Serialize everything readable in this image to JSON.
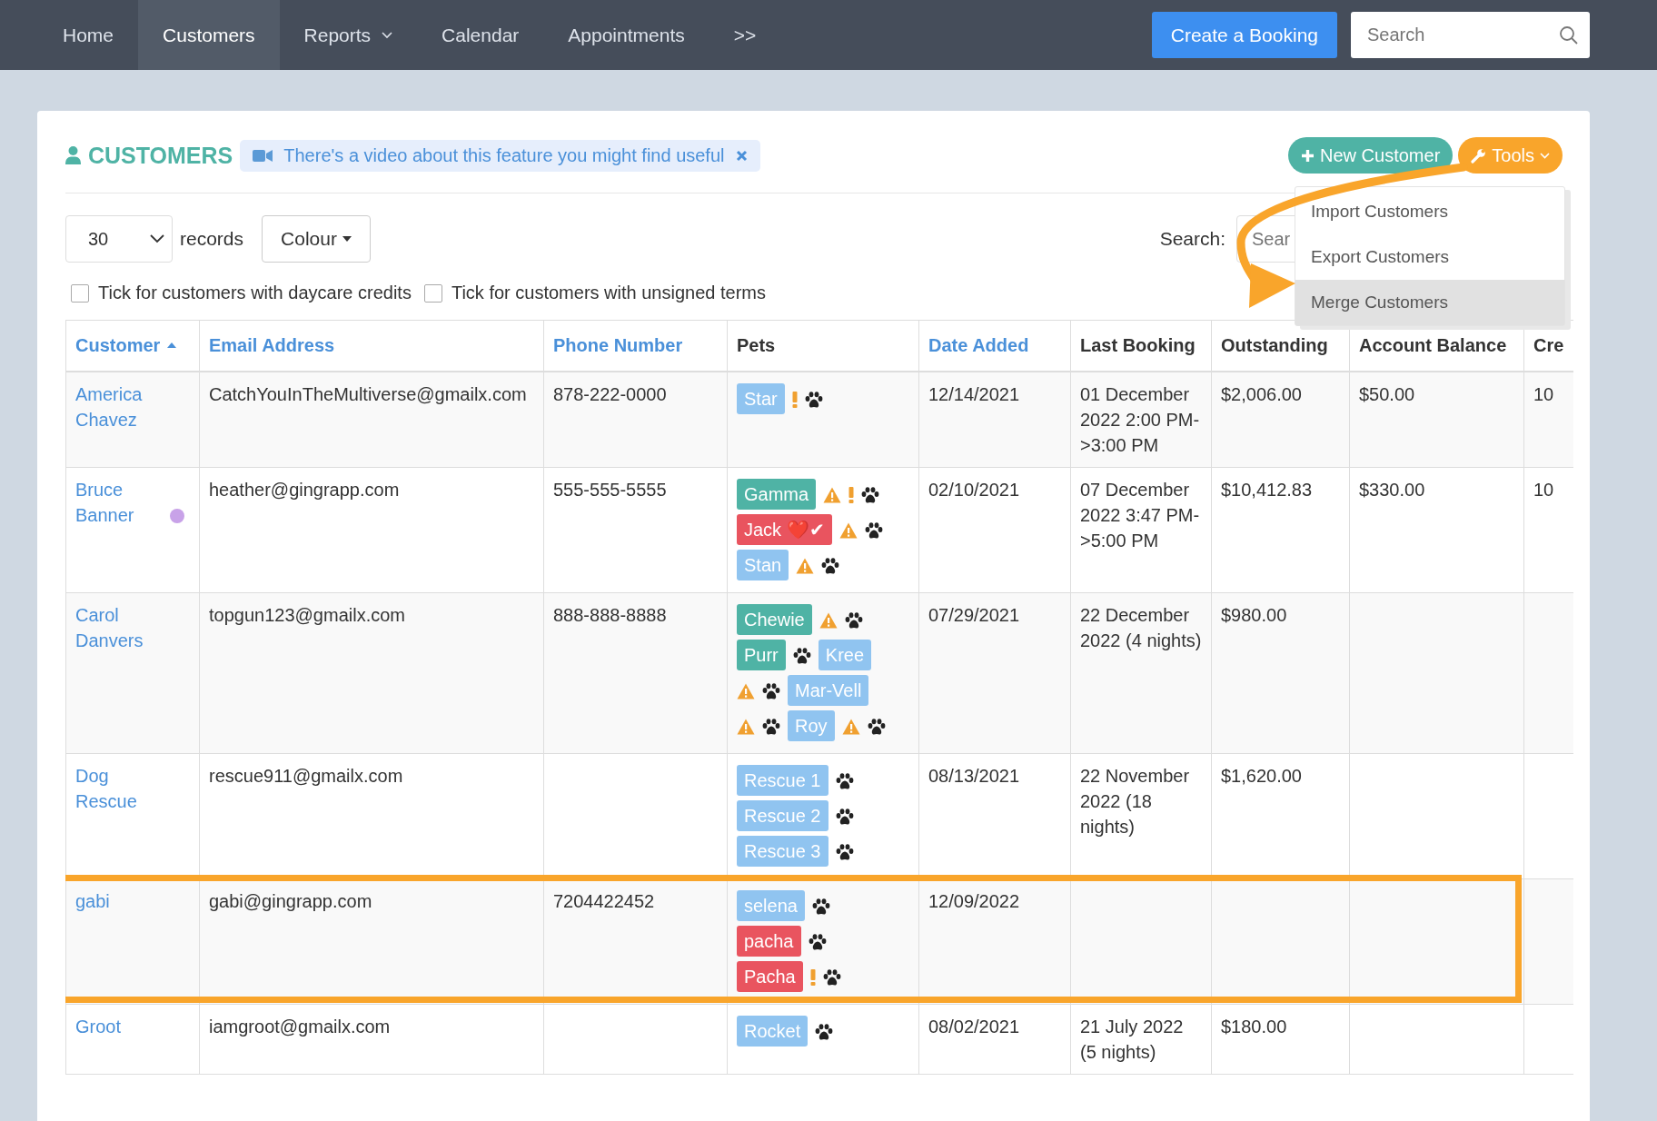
{
  "nav": {
    "items": [
      {
        "label": "Home",
        "selected": false,
        "caret": false
      },
      {
        "label": "Customers",
        "selected": true,
        "caret": false
      },
      {
        "label": "Reports",
        "selected": false,
        "caret": true
      },
      {
        "label": "Calendar",
        "selected": false,
        "caret": false
      },
      {
        "label": "Appointments",
        "selected": false,
        "caret": false
      },
      {
        "label": ">>",
        "selected": false,
        "caret": false
      }
    ],
    "booking_button": "Create a Booking",
    "search": {
      "placeholder": "Search"
    }
  },
  "page": {
    "title": "CUSTOMERS",
    "video_banner": "There's a video about this feature you might find useful",
    "new_button": "New Customer",
    "tools_button": "Tools",
    "tools_menu": [
      {
        "label": "Import Customers",
        "selected": false
      },
      {
        "label": "Export Customers",
        "selected": false
      },
      {
        "label": "Merge Customers",
        "selected": true
      }
    ],
    "records": {
      "value": "30",
      "label": "records"
    },
    "colour_button": "Colour",
    "search_label": "Search:",
    "search_placeholder": "Sear",
    "filters": [
      {
        "label": "Tick for customers with daycare credits",
        "checked": false
      },
      {
        "label": "Tick for customers with unsigned terms",
        "checked": false
      }
    ]
  },
  "table": {
    "columns": [
      {
        "label": "Customer",
        "sortable": true,
        "sorted": true
      },
      {
        "label": "Email Address",
        "sortable": true,
        "sorted": false
      },
      {
        "label": "Phone Number",
        "sortable": true,
        "sorted": false
      },
      {
        "label": "Pets",
        "sortable": false,
        "sorted": false
      },
      {
        "label": "Date Added",
        "sortable": true,
        "sorted": false
      },
      {
        "label": "Last Booking",
        "sortable": false,
        "sorted": false
      },
      {
        "label": "Outstanding",
        "sortable": false,
        "sorted": false
      },
      {
        "label": "Account Balance",
        "sortable": false,
        "sorted": false
      },
      {
        "label": "Cre",
        "sortable": false,
        "sorted": false
      }
    ],
    "rows": [
      {
        "customer": "America Chavez",
        "highlighted": false,
        "email": "CatchYouInTheMultiverse@gmailx.com",
        "phone": "878-222-0000",
        "pets": [
          {
            "name": "Star",
            "color": "#90c4f0",
            "warning": false,
            "alert": true
          }
        ],
        "date_added": "12/14/2021",
        "last_booking": "01 December 2022 2:00 PM->3:00 PM",
        "outstanding": "$2,006.00",
        "balance": "$50.00",
        "column_9": "10"
      },
      {
        "customer": "Bruce Banner",
        "color": "#c8a2e8",
        "highlighted": false,
        "email": "heather@gingrapp.com",
        "phone": "555-555-5555",
        "pets": [
          {
            "name": "Gamma",
            "color": "#4fb3a5",
            "warning": true,
            "alert": true
          },
          {
            "name": "Jack ❤️✔",
            "color": "#e9545f",
            "warning": true,
            "alert": false
          },
          {
            "name": "Stan",
            "color": "#90c4f0",
            "warning": true,
            "alert": false
          }
        ],
        "date_added": "02/10/2021",
        "last_booking": "07 December 2022 3:47 PM->5:00 PM",
        "outstanding": "$10,412.83",
        "balance": "$330.00",
        "column_9": "10"
      },
      {
        "customer": "Carol Danvers",
        "highlighted": false,
        "email": "topgun123@gmailx.com",
        "phone": "888-888-8888",
        "pets": [
          {
            "name": "Chewie",
            "color": "#4fb3a5",
            "warning": true,
            "alert": false
          },
          {
            "name": "Purr",
            "color": "#4fb3a5",
            "warning": false,
            "alert": false
          },
          {
            "name": "Kree",
            "color": "#90c4f0",
            "warning": true,
            "alert": false
          },
          {
            "name": "Mar-Vell",
            "color": "#90c4f0",
            "warning": true,
            "alert": false
          },
          {
            "name": "Roy",
            "color": "#90c4f0",
            "warning": true,
            "alert": false
          }
        ],
        "date_added": "07/29/2021",
        "last_booking": "22 December 2022 (4 nights)",
        "outstanding": "$980.00"
      },
      {
        "customer": "Dog Rescue",
        "highlighted": false,
        "email": "rescue911@gmailx.com",
        "pets": [
          {
            "name": "Rescue 1",
            "color": "#90c4f0",
            "warning": false,
            "alert": false
          },
          {
            "name": "Rescue 2",
            "color": "#90c4f0",
            "warning": false,
            "alert": false
          },
          {
            "name": "Rescue 3",
            "color": "#90c4f0",
            "warning": false,
            "alert": false
          }
        ],
        "date_added": "08/13/2021",
        "last_booking": "22 November 2022 (18 nights)",
        "outstanding": "$1,620.00"
      },
      {
        "customer": "gabi",
        "highlighted": true,
        "email": "gabi@gingrapp.com",
        "phone": "7204422452",
        "pets": [
          {
            "name": "selena",
            "color": "#90c4f0",
            "warning": false,
            "alert": false
          },
          {
            "name": "pacha",
            "color": "#e9545f",
            "warning": false,
            "alert": false
          },
          {
            "name": "Pacha",
            "color": "#e9545f",
            "warning": false,
            "alert": true
          }
        ],
        "date_added": "12/09/2022"
      },
      {
        "customer": "Groot",
        "highlighted": false,
        "email": "iamgroot@gmailx.com",
        "pets": [
          {
            "name": "Rocket",
            "color": "#90c4f0",
            "warning": false,
            "alert": false
          }
        ],
        "date_added": "08/02/2021",
        "last_booking": "21 July 2022 (5 nights)",
        "outstanding": "$180.00"
      }
    ]
  }
}
